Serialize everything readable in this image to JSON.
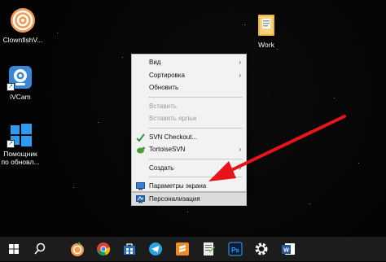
{
  "desktop": {
    "icons": [
      {
        "label": "ClownfishV..."
      },
      {
        "label": "iVCam"
      },
      {
        "label": "Помощник\nпо обновл..."
      },
      {
        "label": "Work"
      }
    ]
  },
  "context_menu": {
    "items": [
      {
        "label": "Вид",
        "submenu": true
      },
      {
        "label": "Сортировка",
        "submenu": true
      },
      {
        "label": "Обновить"
      },
      {
        "label": "Вставить",
        "disabled": true
      },
      {
        "label": "Вставить ярлык",
        "disabled": true
      },
      {
        "label": "SVN Checkout..."
      },
      {
        "label": "TortoiseSVN",
        "submenu": true
      },
      {
        "label": "Создать",
        "submenu": true
      },
      {
        "label": "Параметры экрана"
      },
      {
        "label": "Персонализация",
        "highlighted": true
      }
    ],
    "arrow_glyph": "›"
  },
  "colors": {
    "annotation_arrow": "#e8141b",
    "menu_bg": "#f2f2f2",
    "taskbar_bg": "#1c1c1c"
  },
  "taskbar": {
    "items": [
      "windows-start-icon",
      "search-icon",
      "clownfish-icon",
      "chrome-icon",
      "store-icon",
      "telegram-icon",
      "sublime-icon",
      "notepad-icon",
      "photoshop-icon",
      "settings-gear-icon",
      "word-icon"
    ]
  }
}
